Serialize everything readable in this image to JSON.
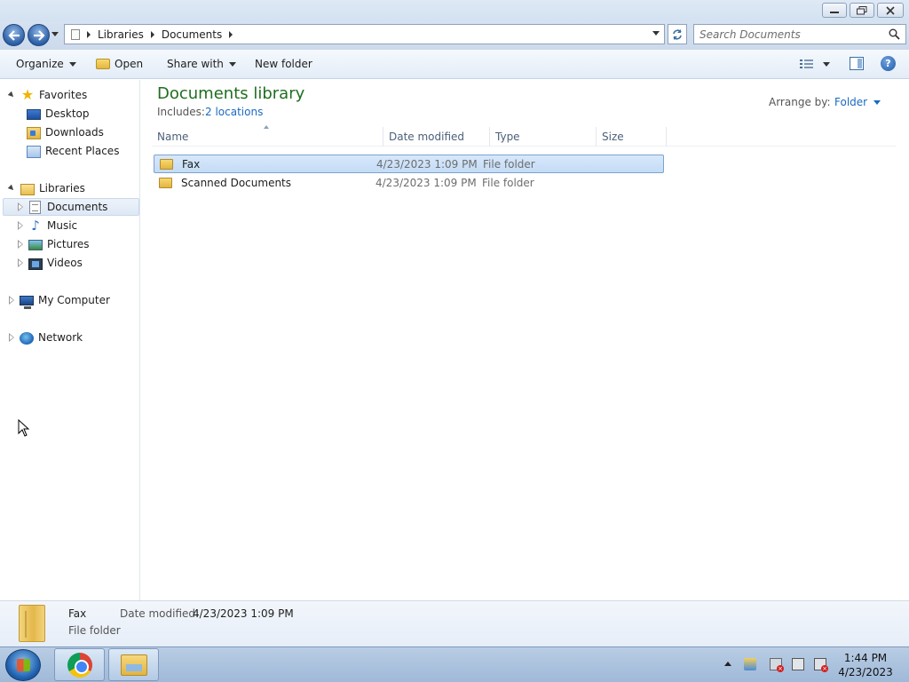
{
  "window": {
    "minimize_label": "—",
    "maximize_label": "❐",
    "close_label": "✕"
  },
  "address": {
    "breadcrumbs": [
      "Libraries",
      "Documents"
    ],
    "search_placeholder": "Search Documents"
  },
  "toolbar": {
    "organize_label": "Organize",
    "open_label": "Open",
    "share_label": "Share with",
    "new_folder_label": "New folder",
    "help_label": "?"
  },
  "nav": {
    "favorites": {
      "label": "Favorites",
      "items": [
        "Desktop",
        "Downloads",
        "Recent Places"
      ]
    },
    "libraries": {
      "label": "Libraries",
      "items": [
        "Documents",
        "Music",
        "Pictures",
        "Videos"
      ],
      "selected": "Documents"
    },
    "computer_label": "My Computer",
    "network_label": "Network"
  },
  "library": {
    "title": "Documents library",
    "includes_label": "Includes:",
    "locations_link": "2 locations",
    "arrange_label": "Arrange by:",
    "arrange_value": "Folder"
  },
  "columns": [
    "Name",
    "Date modified",
    "Type",
    "Size"
  ],
  "files": [
    {
      "name": "Fax",
      "date": "4/23/2023 1:09 PM",
      "type": "File folder",
      "size": "",
      "selected": true
    },
    {
      "name": "Scanned Documents",
      "date": "4/23/2023 1:09 PM",
      "type": "File folder",
      "size": "",
      "selected": false
    }
  ],
  "details": {
    "name": "Fax",
    "type": "File folder",
    "date_label": "Date modified:",
    "date_value": "4/23/2023 1:09 PM"
  },
  "clock": {
    "time": "1:44 PM",
    "date": "4/23/2023"
  },
  "icons": {
    "favorites": "star-icon",
    "desktop": "desktop-icon",
    "downloads": "downloads-icon",
    "recent": "recent-places-icon",
    "libraries": "libraries-icon",
    "documents": "documents-icon",
    "music": "music-icon",
    "pictures": "pictures-icon",
    "videos": "videos-icon",
    "computer": "computer-icon",
    "network": "network-icon"
  },
  "colors": {
    "library_title": "#1e6e1e",
    "link": "#1a6ac2",
    "selection": "#c3dcf6"
  }
}
